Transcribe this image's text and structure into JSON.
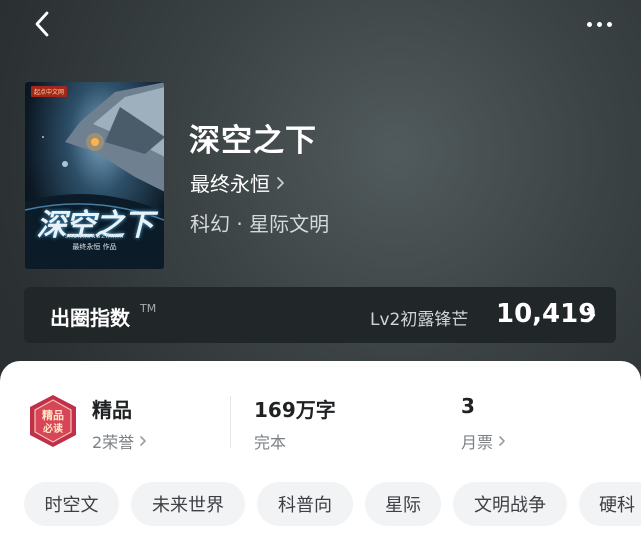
{
  "nav": {
    "back_icon": "chevron-left-icon",
    "more_icon": "more-horizontal-icon"
  },
  "book": {
    "title": "深空之下",
    "author": "最终永恒",
    "genre": "科幻 · 星际文明",
    "cover": {
      "publisher": "起点中文网",
      "title": "深空之下",
      "pinyin": "SHENKONGZHIXIA",
      "author_line": "最终永恒 作品"
    }
  },
  "index": {
    "label": "出圈指数",
    "tm": "TM",
    "level": "Lv2初露锋芒",
    "value": "10,419"
  },
  "stats": [
    {
      "title": "精品",
      "sub": "2荣誉"
    },
    {
      "title": "169万字",
      "sub": "完本"
    },
    {
      "title": "3",
      "sub": "月票"
    }
  ],
  "badge": {
    "text_line1": "精品",
    "text_line2": "必读"
  },
  "tags": [
    "时空文",
    "未来世界",
    "科普向",
    "星际",
    "文明战争",
    "硬科"
  ],
  "colors": {
    "panel": "#ffffff",
    "header_bg": "#2f3436",
    "index_bar": "#212628",
    "badge": "#c0304a"
  }
}
